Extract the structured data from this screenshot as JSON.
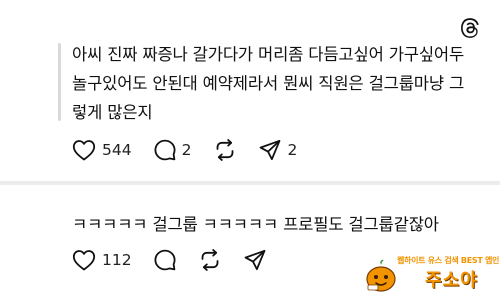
{
  "app": {
    "logo_icon": "threads-logo-icon"
  },
  "posts": [
    {
      "text": "아씨 진짜 짜증나 갈가다가 머리좀 다듬고싶어 가구싶어두\n놀구있어도 안된대 예약제라서 뭔씨 직원은 걸그룹마냥 그\n렇게 많은지",
      "likes": "544",
      "comments": "2",
      "shares": "2"
    },
    {
      "text": "ㅋㅋㅋㅋㅋ 걸그룹 ㅋㅋㅋㅋㅋ 프로필도 걸그룹같잖아",
      "likes": "112",
      "comments": "",
      "shares": ""
    }
  ],
  "watermark": {
    "sub": "웹하이트 유스 검색 BEST 앱인",
    "main": "주소야",
    "color": "#f29400"
  }
}
